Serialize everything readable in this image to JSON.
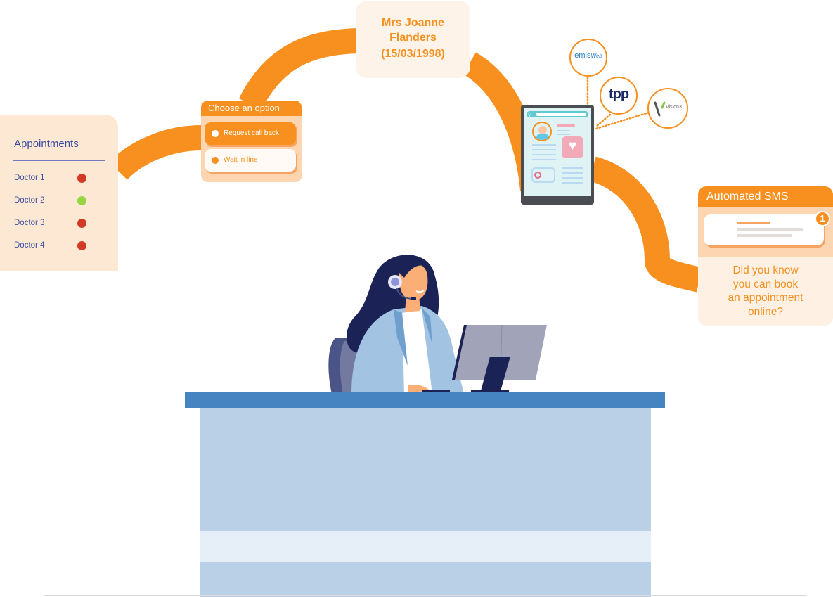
{
  "colors": {
    "orange": "#f7901e",
    "peach": "#fde8d3",
    "navy": "#1b2356",
    "status_busy": "#d13b26",
    "status_available": "#94d544",
    "desk_blue": "#4584c1"
  },
  "appointments": {
    "title": "Appointments",
    "doctors": [
      {
        "label": "Doctor 1",
        "status": "busy",
        "color": "#d13b26"
      },
      {
        "label": "Doctor 2",
        "status": "available",
        "color": "#94d544"
      },
      {
        "label": "Doctor 3",
        "status": "busy",
        "color": "#d13b26"
      },
      {
        "label": "Doctor 4",
        "status": "busy",
        "color": "#d13b26"
      }
    ]
  },
  "options": {
    "title": "Choose an option",
    "items": [
      {
        "label": "Request call back",
        "selected": true
      },
      {
        "label": "Wait in line",
        "selected": false
      }
    ]
  },
  "patient": {
    "name_line1": "Mrs Joanne",
    "name_line2": "Flanders",
    "dob": "(15/03/1998)"
  },
  "integrations": [
    {
      "name": "emis",
      "label_main": "emis",
      "label_sub": "Web"
    },
    {
      "name": "tpp",
      "label_main": "tpp"
    },
    {
      "name": "vision",
      "label_main": "V",
      "label_sub": "Vision3"
    }
  ],
  "sms": {
    "title": "Automated SMS",
    "badge_count": "1",
    "message_lines": [
      "Did you know",
      "you can book",
      "an appointment",
      "online?"
    ]
  }
}
